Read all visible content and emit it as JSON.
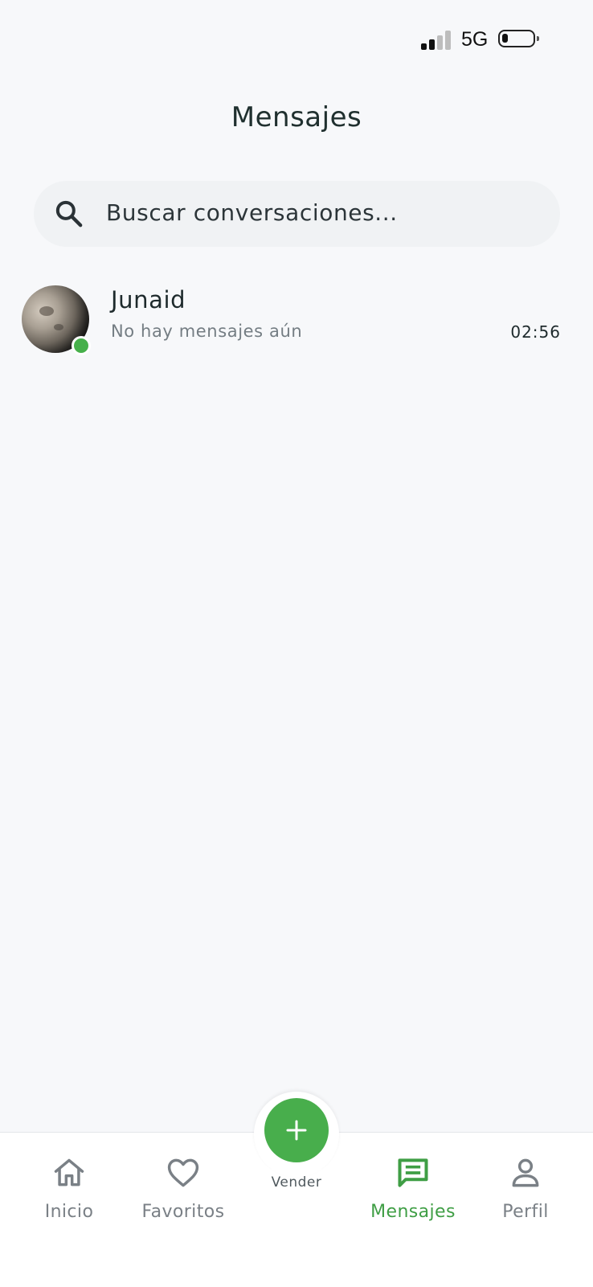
{
  "status_bar": {
    "network": "5G",
    "signal_bars_active": 2,
    "signal_bars_total": 4,
    "battery_level": 0.12
  },
  "header": {
    "title": "Mensajes"
  },
  "search": {
    "placeholder": "Buscar conversaciones...",
    "icon": "search-icon"
  },
  "conversations": [
    {
      "name": "Junaid",
      "last_message": "No hay mensajes aún",
      "time": "02:56",
      "online": true,
      "avatar": "moon-photo"
    }
  ],
  "bottom_nav": {
    "items": [
      {
        "label": "Inicio",
        "icon": "home-icon",
        "active": false
      },
      {
        "label": "Favoritos",
        "icon": "heart-icon",
        "active": false
      },
      {
        "label": "Mensajes",
        "icon": "message-icon",
        "active": true
      },
      {
        "label": "Perfil",
        "icon": "user-icon",
        "active": false
      }
    ],
    "fab": {
      "label": "Vender",
      "icon": "plus-icon"
    }
  },
  "colors": {
    "accent": "#48ae4c",
    "inactive": "#7a8086",
    "background": "#f7f8fa",
    "online": "#46b04a"
  }
}
